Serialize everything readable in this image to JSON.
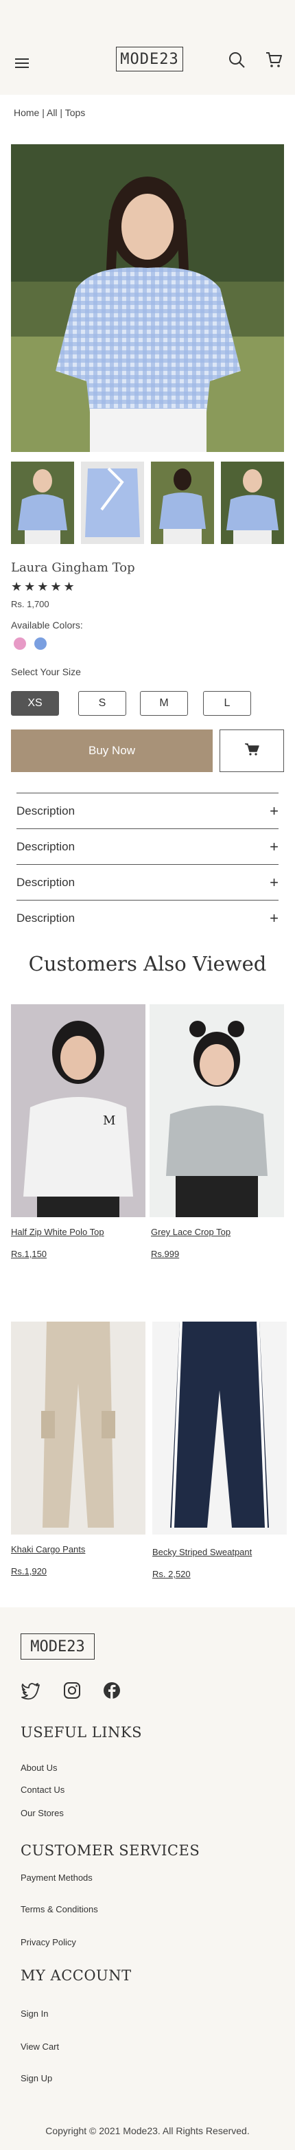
{
  "header": {
    "logo": "MODE23"
  },
  "breadcrumb": "Home | All | Tops",
  "product": {
    "title": "Laura Gingham Top",
    "stars": "★★★★★",
    "price": "Rs. 1,700",
    "colors_label": "Available Colors:",
    "colors": [
      "#e79ac6",
      "#7a9fe0"
    ],
    "size_label": "Select Your Size",
    "sizes": [
      "XS",
      "S",
      "M",
      "L"
    ],
    "selected_size": "XS",
    "buy_label": "Buy Now"
  },
  "accordion": [
    {
      "label": "Description"
    },
    {
      "label": "Description"
    },
    {
      "label": "Description"
    },
    {
      "label": "Description"
    }
  ],
  "also_viewed": {
    "title": "Customers Also Viewed",
    "items": [
      {
        "name": "Half Zip White Polo Top",
        "price": "Rs.1,150"
      },
      {
        "name": "Grey Lace Crop Top",
        "price": "Rs.999"
      },
      {
        "name": "Khaki Cargo Pants",
        "price": "Rs.1,920"
      },
      {
        "name": "Becky Striped Sweatpant",
        "price": "Rs. 2,520"
      }
    ]
  },
  "footer": {
    "logo": "MODE23",
    "useful_links_title": "USEFUL LINKS",
    "useful_links": [
      "About Us",
      "Contact Us",
      "Our Stores"
    ],
    "customer_services_title": "CUSTOMER SERVICES",
    "customer_services": [
      "Payment Methods",
      "Terms & Conditions",
      "Privacy Policy"
    ],
    "my_account_title": "MY ACCOUNT",
    "my_account": [
      "Sign In",
      "View Cart",
      "Sign Up"
    ],
    "copyright": "Copyright © 2021 Mode23. All Rights Reserved."
  }
}
